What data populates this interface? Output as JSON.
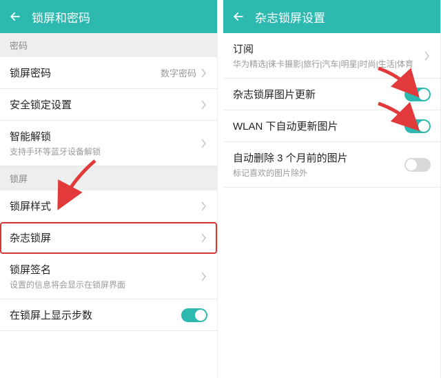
{
  "left": {
    "title": "锁屏和密码",
    "sections": {
      "password_header": "密码",
      "lockscreen_header": "锁屏"
    },
    "items": {
      "lock_password": {
        "label": "锁屏密码",
        "value": "数字密码"
      },
      "secure_lock": {
        "label": "安全锁定设置"
      },
      "smart_unlock": {
        "label": "智能解锁",
        "sub": "支持手环等蓝牙设备解锁"
      },
      "lock_style": {
        "label": "锁屏样式"
      },
      "magazine_lock": {
        "label": "杂志锁屏"
      },
      "lock_signature": {
        "label": "锁屏签名",
        "sub": "设置的信息将会显示在锁屏界面"
      },
      "show_steps": {
        "label": "在锁屏上显示步数",
        "toggle": true
      }
    }
  },
  "right": {
    "title": "杂志锁屏设置",
    "items": {
      "subscribe": {
        "label": "订阅",
        "sub": "华为精选|徕卡摄影|旅行|汽车|明星|时尚|生活|体育"
      },
      "update_images": {
        "label": "杂志锁屏图片更新",
        "toggle": true
      },
      "wlan_update": {
        "label": "WLAN 下自动更新图片",
        "toggle": true
      },
      "auto_delete": {
        "label": "自动删除 3 个月前的图片",
        "sub": "标记喜欢的图片除外",
        "toggle": false
      }
    }
  }
}
